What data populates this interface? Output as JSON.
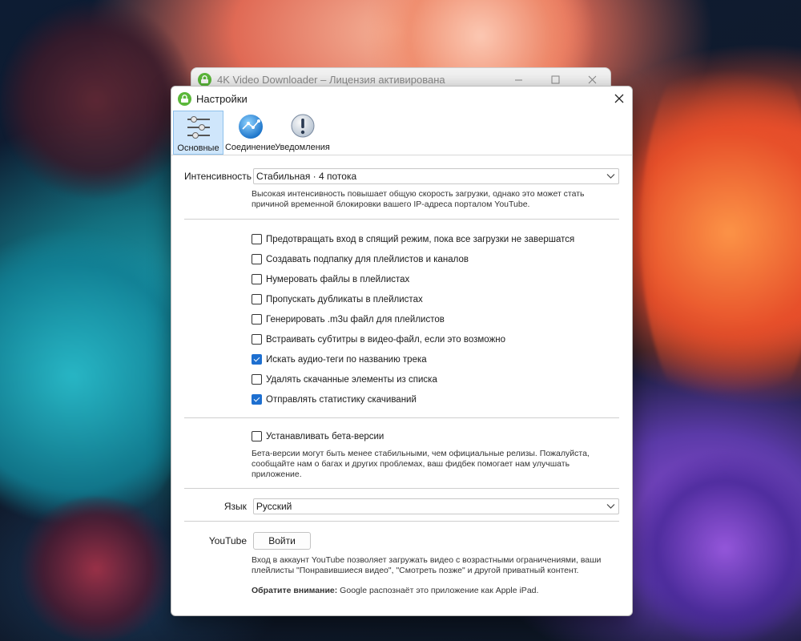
{
  "background_window": {
    "title": "4K Video Downloader – Лицензия активирована",
    "minimize_icon": "minimize-icon",
    "maximize_icon": "maximize-icon",
    "close_icon": "close-icon"
  },
  "dialog": {
    "title": "Настройки",
    "close_icon": "close-icon",
    "tabs": [
      {
        "label": "Основные",
        "icon": "sliders-icon",
        "active": true
      },
      {
        "label": "Соединение",
        "icon": "globe-icon",
        "active": false
      },
      {
        "label": "Уведомления",
        "icon": "alert-icon",
        "active": false
      }
    ]
  },
  "intensity": {
    "label": "Интенсивность",
    "value": "Стабильная · 4 потока",
    "hint": "Высокая интенсивность повышает общую скорость загрузки, однако это может стать причиной временной блокировки вашего IP-адреса порталом YouTube."
  },
  "options": [
    {
      "label": "Предотвращать вход в спящий режим, пока все загрузки не завершатся",
      "checked": false
    },
    {
      "label": "Создавать подпапку для плейлистов и каналов",
      "checked": false
    },
    {
      "label": "Нумеровать файлы в плейлистах",
      "checked": false
    },
    {
      "label": "Пропускать дубликаты в плейлистах",
      "checked": false
    },
    {
      "label": "Генерировать .m3u файл для плейлистов",
      "checked": false
    },
    {
      "label": "Встраивать субтитры в видео-файл, если это возможно",
      "checked": false
    },
    {
      "label": "Искать аудио-теги по названию трека",
      "checked": true
    },
    {
      "label": "Удалять скачанные элементы из списка",
      "checked": false
    },
    {
      "label": "Отправлять статистику скачиваний",
      "checked": true
    }
  ],
  "beta": {
    "label": "Устанавливать бета-версии",
    "checked": false,
    "hint": "Бета-версии могут быть менее стабильными, чем официальные релизы.  Пожалуйста, сообщайте нам о багах и других проблемах, ваш фидбек помогает нам улучшать приложение."
  },
  "language": {
    "label": "Язык",
    "value": "Русский"
  },
  "youtube": {
    "label": "YouTube",
    "button": "Войти",
    "hint": "Вход в аккаунт YouTube позволяет загружать видео с возрастными ограничениями, ваши плейлисты \"Понравившиеся видео\", \"Смотреть позже\" и другой приватный контент.",
    "note_bold": "Обратите внимание:",
    "note_text": " Google распознаёт это приложение как Apple iPad."
  },
  "colors": {
    "accent": "#1d6fd0",
    "active_tab_bg": "#cfe6fb",
    "app_icon": "#5bb83a"
  }
}
